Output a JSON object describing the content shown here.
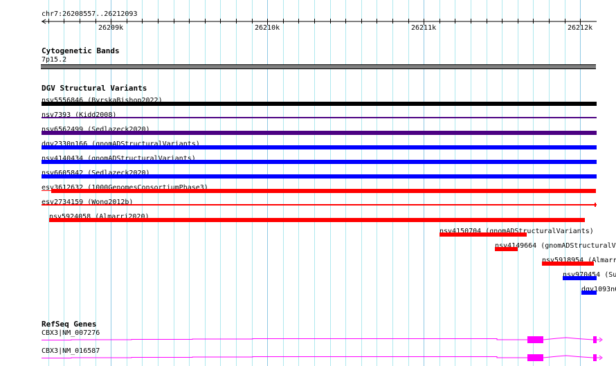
{
  "location": "chr7:26208557..26212093",
  "ruler": {
    "start": 26208557,
    "end": 26212093,
    "ticks": [
      "26209k",
      "26210k",
      "26211k",
      "26212k"
    ]
  },
  "tracks": {
    "cytobands": {
      "title": "Cytogenetic Bands",
      "band": "7p15.2",
      "color": "#808080"
    },
    "dgv": {
      "title": "DGV Structural Variants",
      "features": [
        {
          "label": "nsv5556846 (ByrskaBishop2022)",
          "color": "#000000"
        },
        {
          "label": "nsv7393 (Kidd2008)",
          "color": "#4b0082"
        },
        {
          "label": "nsv6562499 (Sedlazeck2020)",
          "color": "#4b0082"
        },
        {
          "label": "dgv2330n166 (gnomADStructuralVariants)",
          "color": "#0000ff"
        },
        {
          "label": "nsv4140434 (gnomADStructuralVariants)",
          "color": "#0000ff"
        },
        {
          "label": "nsv6605842 (Sedlazeck2020)",
          "color": "#0000ff"
        },
        {
          "label": "esv3612632 (1000GenomesConsortiumPhase3)",
          "color": "#ff0000"
        },
        {
          "label": "esv2734159 (Wong2012b)",
          "color": "#ff0000"
        },
        {
          "label": "nsv5924058 (Almarri2020)",
          "color": "#ff0000"
        },
        {
          "label": "nsv4150704 (gnomADStructuralVariants)",
          "color": "#ff0000"
        },
        {
          "label": "nsv4149664 (gnomADStructuralVa",
          "color": "#ff0000"
        },
        {
          "label": "nsv5918954 (Almarr",
          "color": "#ff0000"
        },
        {
          "label": "nsv970454 (Su",
          "color": "#0000ff"
        },
        {
          "label": "dgv1093n6",
          "color": "#0000ff"
        }
      ]
    },
    "refseq": {
      "title": "RefSeq Genes",
      "color": "#ff00ff",
      "genes": [
        {
          "label": "CBX3|NM_007276"
        },
        {
          "label": "CBX3|NM_016587"
        }
      ]
    }
  }
}
